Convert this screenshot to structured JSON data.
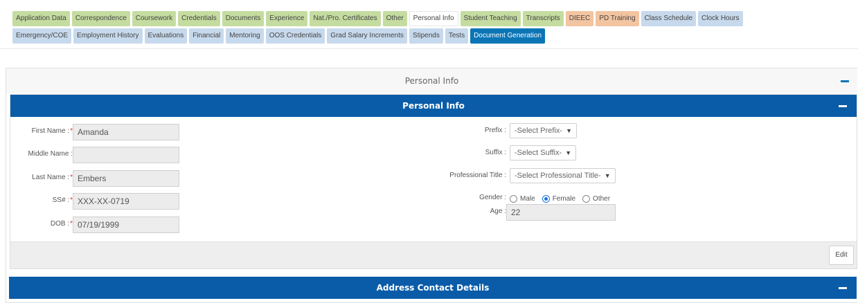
{
  "tabs": {
    "row1": [
      {
        "label": "Application Data",
        "color": "green"
      },
      {
        "label": "Correspondence",
        "color": "green"
      },
      {
        "label": "Coursework",
        "color": "green"
      },
      {
        "label": "Credentials",
        "color": "green"
      },
      {
        "label": "Documents",
        "color": "green"
      },
      {
        "label": "Experience",
        "color": "green"
      },
      {
        "label": "Nat./Pro. Certificates",
        "color": "green"
      },
      {
        "label": "Other",
        "color": "green"
      },
      {
        "label": "Personal Info",
        "color": "white"
      },
      {
        "label": "Student Teaching",
        "color": "green"
      },
      {
        "label": "Transcripts",
        "color": "green"
      },
      {
        "label": "DIEEC",
        "color": "orange"
      },
      {
        "label": "PD Training",
        "color": "orange"
      },
      {
        "label": "Class Schedule",
        "color": "blue"
      },
      {
        "label": "Clock Hours",
        "color": "blue"
      }
    ],
    "row2": [
      {
        "label": "Emergency/COE",
        "color": "blue"
      },
      {
        "label": "Employment History",
        "color": "blue"
      },
      {
        "label": "Evaluations",
        "color": "blue"
      },
      {
        "label": "Financial",
        "color": "blue"
      },
      {
        "label": "Mentoring",
        "color": "blue"
      },
      {
        "label": "OOS Credentials",
        "color": "blue"
      },
      {
        "label": "Grad Salary Increments",
        "color": "blue"
      },
      {
        "label": "Stipends",
        "color": "blue"
      },
      {
        "label": "Tests",
        "color": "blue"
      },
      {
        "label": "Document Generation",
        "color": "active"
      }
    ]
  },
  "outer_panel": {
    "title": "Personal Info"
  },
  "inner_panel": {
    "title": "Personal Info"
  },
  "form": {
    "first_name": {
      "label": "First Name :",
      "required": "*",
      "value": "Amanda"
    },
    "middle_name": {
      "label": "Middle Name :",
      "value": ""
    },
    "last_name": {
      "label": "Last Name :",
      "required": "*",
      "value": "Embers"
    },
    "ssn": {
      "label": "SS# :",
      "required": "*",
      "value": "XXX-XX-0719"
    },
    "dob": {
      "label": "DOB :",
      "required": "*",
      "value": "07/19/1999"
    },
    "prefix": {
      "label": "Prefix :",
      "value": "-Select Prefix-"
    },
    "suffix": {
      "label": "Suffix :",
      "value": "-Select Suffix-"
    },
    "professional_title": {
      "label": "Professional Title :",
      "value": "-Select Professional Title-"
    },
    "gender": {
      "label": "Gender :",
      "options": [
        "Male",
        "Female",
        "Other"
      ],
      "selected": "Female"
    },
    "age": {
      "label": "Age :",
      "value": "22"
    }
  },
  "edit_button": "Edit",
  "address_panel": {
    "title": "Address Contact Details"
  },
  "colors": {
    "primary_blue": "#0a5ca8",
    "active_tab": "#0b75b6",
    "green_tab": "#c5dca0",
    "orange_tab": "#f3c4a0",
    "blue_tab": "#c7d9ec",
    "required": "#e03030"
  },
  "icons": {
    "collapse": "minus-icon",
    "dropdown": "chevron-down-icon"
  }
}
